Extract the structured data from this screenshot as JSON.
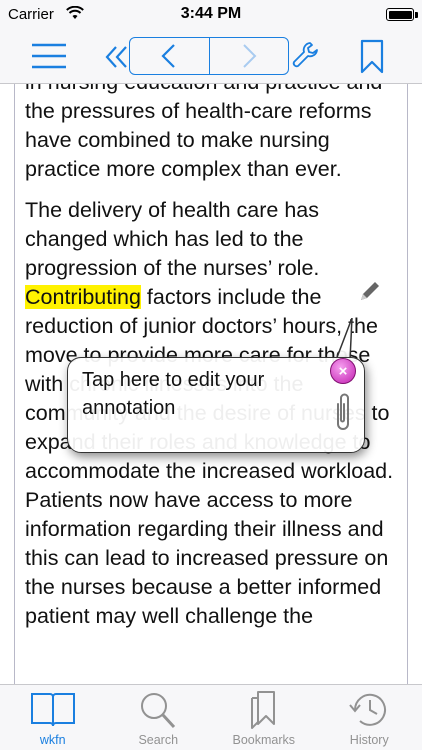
{
  "status_bar": {
    "carrier": "Carrier",
    "time": "3:44 PM",
    "battery_level_pct": 100
  },
  "nav": {
    "icons": [
      "menu-icon",
      "first-page-icon",
      "previous-icon",
      "next-icon",
      "wrench-icon",
      "bookmark-icon"
    ],
    "accent_color": "#1a7fe0"
  },
  "content": {
    "paragraph_1": "in nursing education and practice and the pressures of health-care reforms have combined to make nursing practice more complex than ever.",
    "paragraph_2_before": "The delivery of health care has changed which has led to the progression of the nurses’ role. ",
    "paragraph_2_highlight": "Contributing",
    "paragraph_2_after": " factors include the reduction of junior doctors’ hours, the move to provide more care for those with chronic illnesses into the community and the desire of nurses to expand their roles and knowledge to accommodate the increased workload. Patients now have access to more information regarding their illness and this can lead to increased pressure on the nurses because a better informed patient may well challenge the",
    "highlight_color": "#fff200"
  },
  "annotation_popup": {
    "text": "Tap here to edit your annotation",
    "close_symbol": "×",
    "close_color": "#c21fb0"
  },
  "tabs": [
    {
      "label": "wkfn",
      "icon": "book-icon",
      "active": true
    },
    {
      "label": "Search",
      "icon": "search-icon",
      "active": false
    },
    {
      "label": "Bookmarks",
      "icon": "bookmarks-icon",
      "active": false
    },
    {
      "label": "History",
      "icon": "history-icon",
      "active": false
    }
  ]
}
